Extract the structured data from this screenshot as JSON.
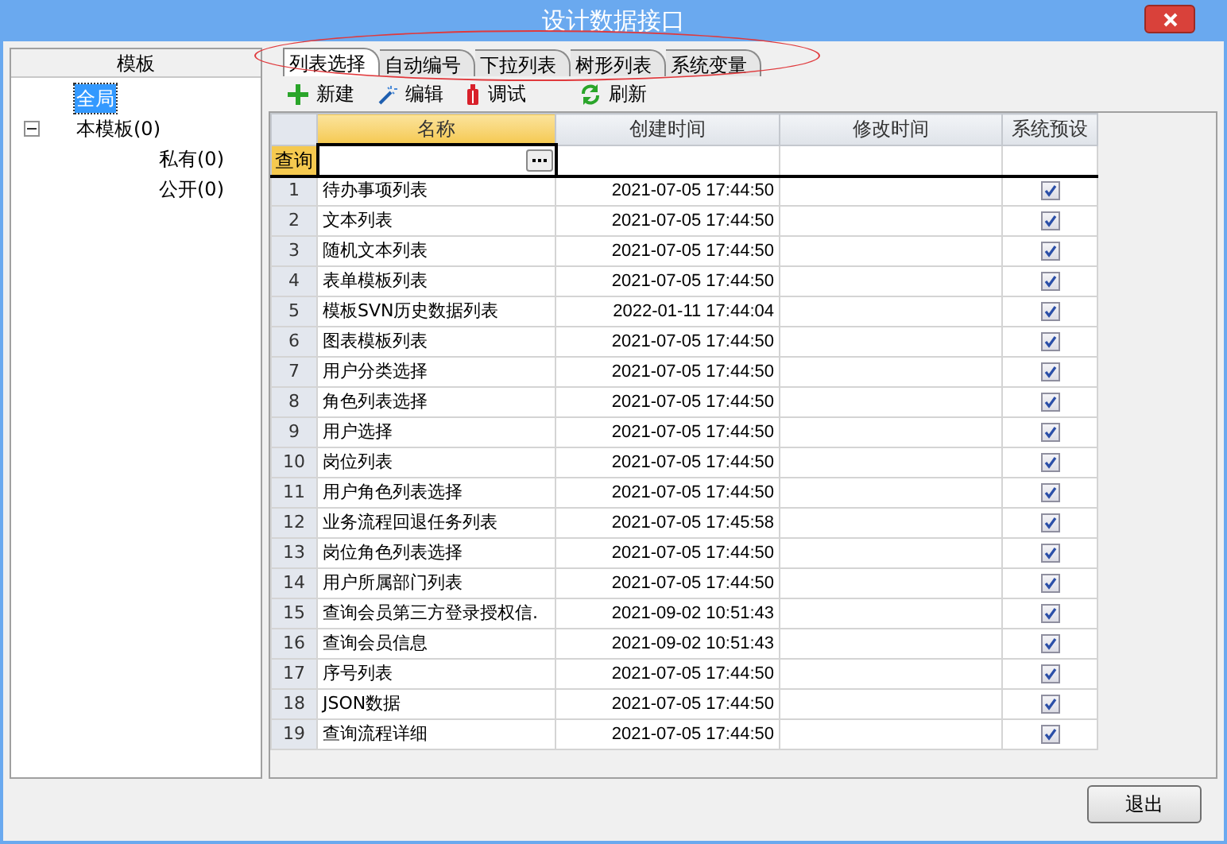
{
  "window": {
    "title": "设计数据接口"
  },
  "sidebar": {
    "header": "模板",
    "tree": [
      {
        "label": "全局",
        "selected": true
      },
      {
        "label": "本模板(0)",
        "selected": false,
        "expanded": true,
        "children": [
          {
            "label": "私有(0)",
            "selected": false
          },
          {
            "label": "公开(0)",
            "selected": false
          }
        ]
      }
    ]
  },
  "tabs": [
    {
      "label": "列表选择",
      "selected": true
    },
    {
      "label": "自动编号",
      "selected": false
    },
    {
      "label": "下拉列表",
      "selected": false
    },
    {
      "label": "树形列表",
      "selected": false
    },
    {
      "label": "系统变量",
      "selected": false
    }
  ],
  "toolbar": [
    {
      "kind": "add",
      "label": "新建"
    },
    {
      "kind": "edit",
      "label": "编辑"
    },
    {
      "kind": "debug",
      "label": "调试"
    },
    {
      "kind": "refresh",
      "label": "刷新"
    }
  ],
  "table": {
    "columns": [
      {
        "label": "名称",
        "selected": true
      },
      {
        "label": "创建时间",
        "selected": false
      },
      {
        "label": "修改时间",
        "selected": false
      },
      {
        "label": "系统预设",
        "selected": false
      }
    ],
    "query_label": "查询",
    "rows": [
      {
        "index": "1",
        "name": "待办事项列表",
        "created": "2021-07-05 17:44:50",
        "system_default": true
      },
      {
        "index": "2",
        "name": "文本列表",
        "created": "2021-07-05 17:44:50",
        "system_default": true
      },
      {
        "index": "3",
        "name": "随机文本列表",
        "created": "2021-07-05 17:44:50",
        "system_default": true
      },
      {
        "index": "4",
        "name": "表单模板列表",
        "created": "2021-07-05 17:44:50",
        "system_default": true
      },
      {
        "index": "5",
        "name": "模板SVN历史数据列表",
        "created": "2022-01-11 17:44:04",
        "system_default": true
      },
      {
        "index": "6",
        "name": "图表模板列表",
        "created": "2021-07-05 17:44:50",
        "system_default": true
      },
      {
        "index": "7",
        "name": "用户分类选择",
        "created": "2021-07-05 17:44:50",
        "system_default": true
      },
      {
        "index": "8",
        "name": "角色列表选择",
        "created": "2021-07-05 17:44:50",
        "system_default": true
      },
      {
        "index": "9",
        "name": "用户选择",
        "created": "2021-07-05 17:44:50",
        "system_default": true
      },
      {
        "index": "10",
        "name": "岗位列表",
        "created": "2021-07-05 17:44:50",
        "system_default": true
      },
      {
        "index": "11",
        "name": "用户角色列表选择",
        "created": "2021-07-05 17:44:50",
        "system_default": true
      },
      {
        "index": "12",
        "name": "业务流程回退任务列表",
        "created": "2021-07-05 17:45:58",
        "system_default": true
      },
      {
        "index": "13",
        "name": "岗位角色列表选择",
        "created": "2021-07-05 17:44:50",
        "system_default": true
      },
      {
        "index": "14",
        "name": "用户所属部门列表",
        "created": "2021-07-05 17:44:50",
        "system_default": true
      },
      {
        "index": "15",
        "name": "查询会员第三方登录授权信.",
        "created": "2021-09-02 10:51:43",
        "system_default": true
      },
      {
        "index": "16",
        "name": "查询会员信息",
        "created": "2021-09-02 10:51:43",
        "system_default": true
      },
      {
        "index": "17",
        "name": "序号列表",
        "created": "2021-07-05 17:44:50",
        "system_default": true
      },
      {
        "index": "18",
        "name": "JSON数据",
        "created": "2021-07-05 17:44:50",
        "system_default": true
      },
      {
        "index": "19",
        "name": "查询流程详细",
        "created": "2021-07-05 17:44:50",
        "system_default": true
      }
    ]
  },
  "buttons": [
    {
      "label": "退出"
    }
  ]
}
